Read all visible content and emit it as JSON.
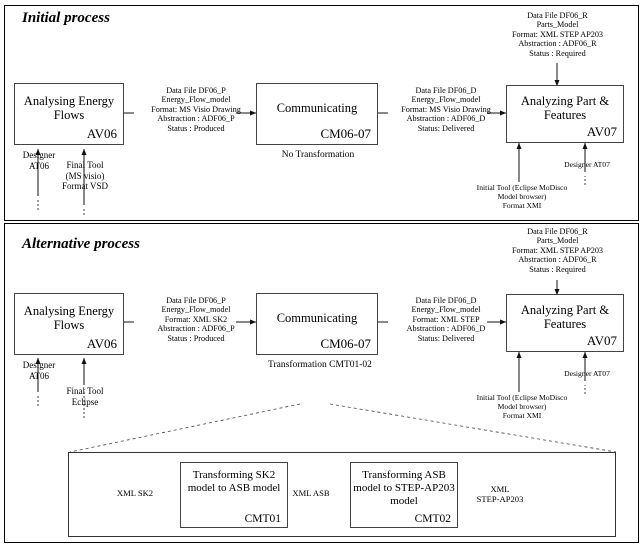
{
  "diagram": {
    "panels": [
      {
        "title": "Initial process"
      },
      {
        "title": "Alternative process"
      }
    ]
  },
  "initial": {
    "activity_start": {
      "title": "Analysing Energy Flows",
      "code": "AV06"
    },
    "activity_mid": {
      "title": "Communicating",
      "code": "CM06-07"
    },
    "activity_end": {
      "title": "Analyzing Part & Features",
      "code": "AV07"
    },
    "transformation_note": "No Transformation",
    "flow_produced": "Data File DF06_P\nEnergy_Flow_model\nFormat: MS Visio Drawing\nAbstraction : ADF06_P\nStatus : Produced",
    "flow_delivered": "Data File DF06_D\nEnergy_Flow_model\nFormat: MS Visio Drawing\nAbstraction : ADF06_D\nStatus: Delivered",
    "flow_required": "Data File DF06_R\nParts_Model\nFormat: XML STEP AP203\nAbstraction : ADF06_R\nStatus : Required",
    "resource_designer_start": "Designer\nAT06",
    "resource_tool_start": "Final Tool\n(MS visio)\nFormat VSD",
    "resource_tool_end": "Initial Tool (Eclipse MoDisco\nModel browser)\nFormat XMI",
    "resource_designer_end": "Designer AT07"
  },
  "alternative": {
    "activity_start": {
      "title": "Analysing Energy Flows",
      "code": "AV06"
    },
    "activity_mid": {
      "title": "Communicating",
      "code": "CM06-07"
    },
    "activity_end": {
      "title": "Analyzing Part & Features",
      "code": "AV07"
    },
    "transformation_note": "Transformation CMT01-02",
    "flow_produced": "Data File DF06_P\nEnergy_Flow_model\nFormat: XML SK2\nAbstraction : ADF06_P\nStatus : Produced",
    "flow_delivered": "Data File DF06_D\nEnergy_Flow_model\nFormat: XML STEP\nAbstraction : ADF06_D\nStatus: Delivered",
    "flow_required": "Data File DF06_R\nParts_Model\nFormat: XML STEP AP203\nAbstraction : ADF06_R\nStatus : Required",
    "resource_designer_start": "Designer\nAT06",
    "resource_tool_start": "Final Tool\nEclipse",
    "resource_tool_end": "Initial Tool (Eclipse MoDisco\nModel browser)\nFormat XMI",
    "resource_designer_end": "Designer AT07"
  },
  "transformation_detail": {
    "step1": {
      "title": "Transforming SK2 model to ASB model",
      "code": "CMT01"
    },
    "step2": {
      "title": "Transforming ASB model to STEP-AP203 model",
      "code": "CMT02"
    },
    "input_label": "XML SK2",
    "middle_label": "XML ASB",
    "output_label": "XML\nSTEP-AP203"
  }
}
